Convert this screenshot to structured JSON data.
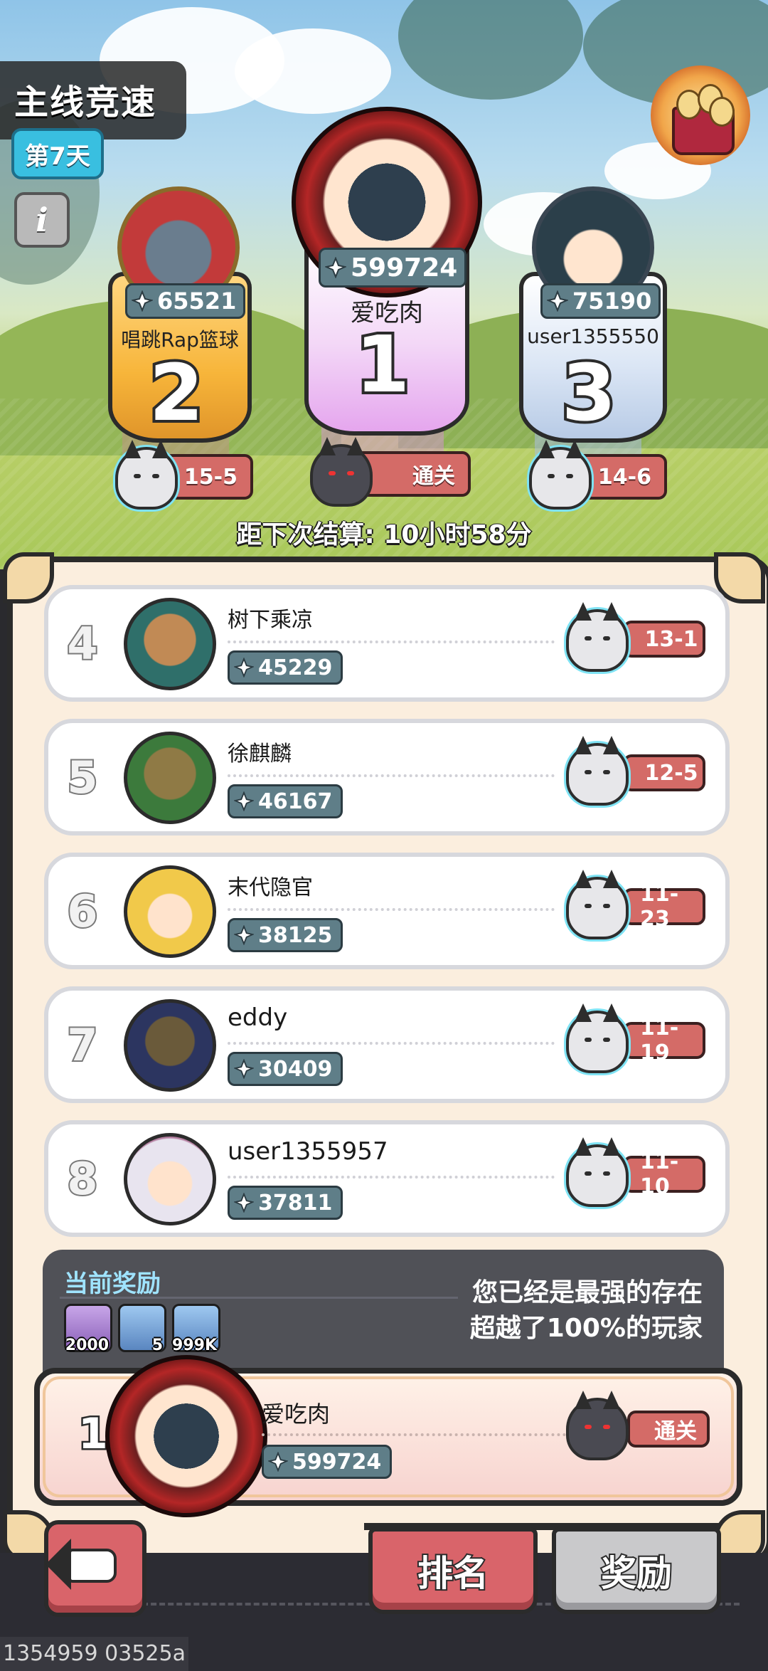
{
  "header": {
    "title": "主线竞速",
    "day_badge": "第7天",
    "info_icon": "i"
  },
  "podium": [
    {
      "rank": "2",
      "name": "唱跳Rap篮球",
      "score": "65521",
      "progress": "15-5"
    },
    {
      "rank": "1",
      "name": "爱吃肉",
      "score": "599724",
      "progress": "通关"
    },
    {
      "rank": "3",
      "name": "user1355550",
      "score": "75190",
      "progress": "14-6"
    }
  ],
  "timer_text": "距下次结算: 10小时58分",
  "list": [
    {
      "rank": "4",
      "name": "树下乘凉",
      "score": "45229",
      "progress": "13-1"
    },
    {
      "rank": "5",
      "name": "徐麒麟",
      "score": "46167",
      "progress": "12-5"
    },
    {
      "rank": "6",
      "name": "末代隐官",
      "score": "38125",
      "progress": "11-23"
    },
    {
      "rank": "7",
      "name": "eddy",
      "score": "30409",
      "progress": "11-19"
    },
    {
      "rank": "8",
      "name": "user1355957",
      "score": "37811",
      "progress": "11-10"
    }
  ],
  "reward": {
    "title": "当前奖励",
    "items": [
      {
        "icon": "gem-icon",
        "count": "2000"
      },
      {
        "icon": "chest-icon",
        "count": "5"
      },
      {
        "icon": "gold-coin-icon",
        "count": "999K"
      }
    ],
    "message_line1": "您已经是最强的存在",
    "message_line2": "超越了100%的玩家"
  },
  "self": {
    "rank": "1",
    "name": "爱吃肉",
    "score": "599724",
    "progress": "通关"
  },
  "buttons": {
    "back_icon": "back-arrow-icon",
    "tab_rank": "排名",
    "tab_reward": "奖励"
  },
  "footer_id": "1354959 03525a",
  "colors": {
    "accent_red": "#d9646a",
    "score_badge": "#5f7e88",
    "panel_bg": "#fbeede",
    "gold": "#f7b53a"
  }
}
